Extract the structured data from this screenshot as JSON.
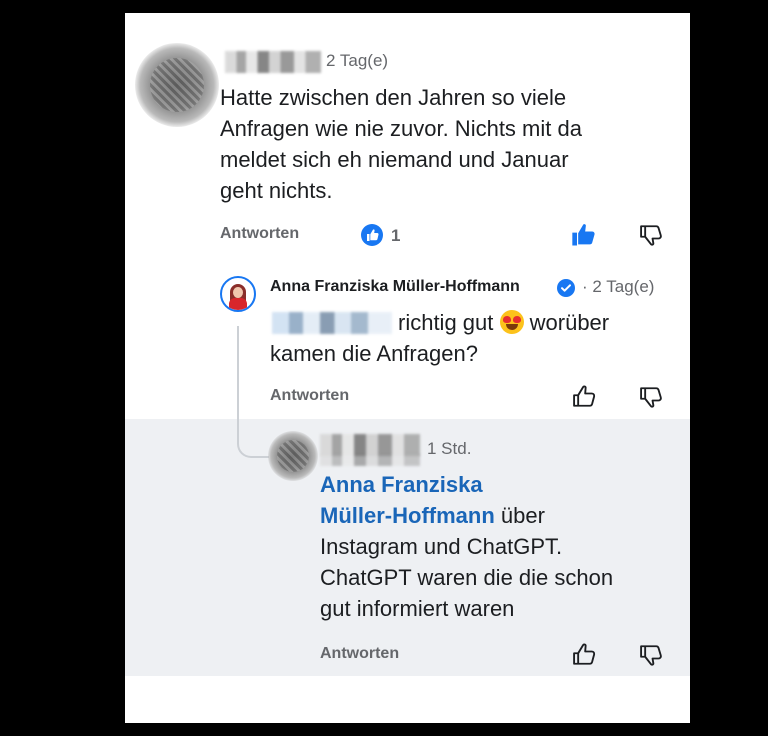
{
  "comments": [
    {
      "author": "",
      "time": "2 Tag(e)",
      "text_lines": [
        "Hatte zwischen den Jahren so viele",
        "Anfragen wie nie zuvor. Nichts mit da",
        "meldet sich eh niemand und Januar",
        "geht nichts."
      ],
      "reply_label": "Antworten",
      "like_count": "1",
      "liked": true
    },
    {
      "author": "Anna Franziska Müller-Hoffmann",
      "verified": true,
      "time": "· 2 Tag(e)",
      "text_line1_suffix": "richtig gut",
      "text_line1_after_emoji": "worüber",
      "text_line2": "kamen die Anfragen?",
      "emoji": "heart-eyes-emoji",
      "reply_label": "Antworten"
    },
    {
      "author": "",
      "time": "1 Std.",
      "mention_line1": "Anna Franziska",
      "mention_line2": "Müller-Hoffmann",
      "text_line2_suffix": "über",
      "text_lines": [
        "Instagram und ChatGPT.",
        "ChatGPT waren die die schon",
        "gut informiert waren"
      ],
      "reply_label": "Antworten"
    }
  ],
  "colors": {
    "like_blue": "#1877f2",
    "mention_blue": "#1a66b8",
    "highlight_bg": "#eef0f3"
  },
  "icons": [
    "thumbs-up-icon",
    "thumbs-down-icon",
    "like-reaction-icon",
    "verified-badge-icon"
  ]
}
